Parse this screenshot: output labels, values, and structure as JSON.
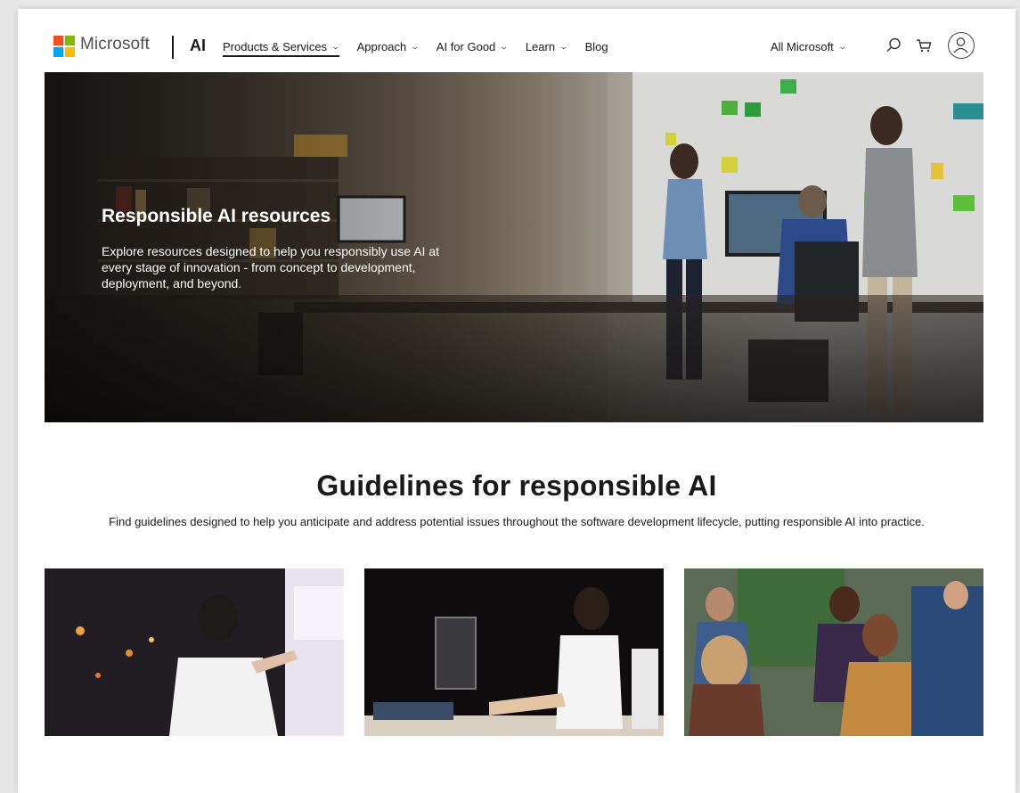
{
  "header": {
    "brand": "Microsoft",
    "product": "AI",
    "nav": [
      {
        "label": "Products & Services",
        "dropdown": true,
        "active": true
      },
      {
        "label": "Approach",
        "dropdown": true,
        "active": false
      },
      {
        "label": "AI for Good",
        "dropdown": true,
        "active": false
      },
      {
        "label": "Learn",
        "dropdown": true,
        "active": false
      },
      {
        "label": "Blog",
        "dropdown": false,
        "active": false
      }
    ],
    "all_microsoft": "All Microsoft",
    "icons": [
      "search-icon",
      "cart-icon",
      "account-icon"
    ]
  },
  "hero": {
    "title": "Responsible AI resources",
    "description": "Explore resources designed to help you responsibly use AI at every stage of innovation - from concept to development, deployment, and beyond."
  },
  "guidelines": {
    "title": "Guidelines for responsible AI",
    "description": "Find guidelines designed to help you anticipate and address potential issues throughout the software development lifecycle, putting responsible AI into practice."
  },
  "colors": {
    "logo_red": "#f25022",
    "logo_green": "#7fba00",
    "logo_blue": "#00a4ef",
    "logo_yellow": "#ffb900",
    "text": "#1a1a1a"
  }
}
